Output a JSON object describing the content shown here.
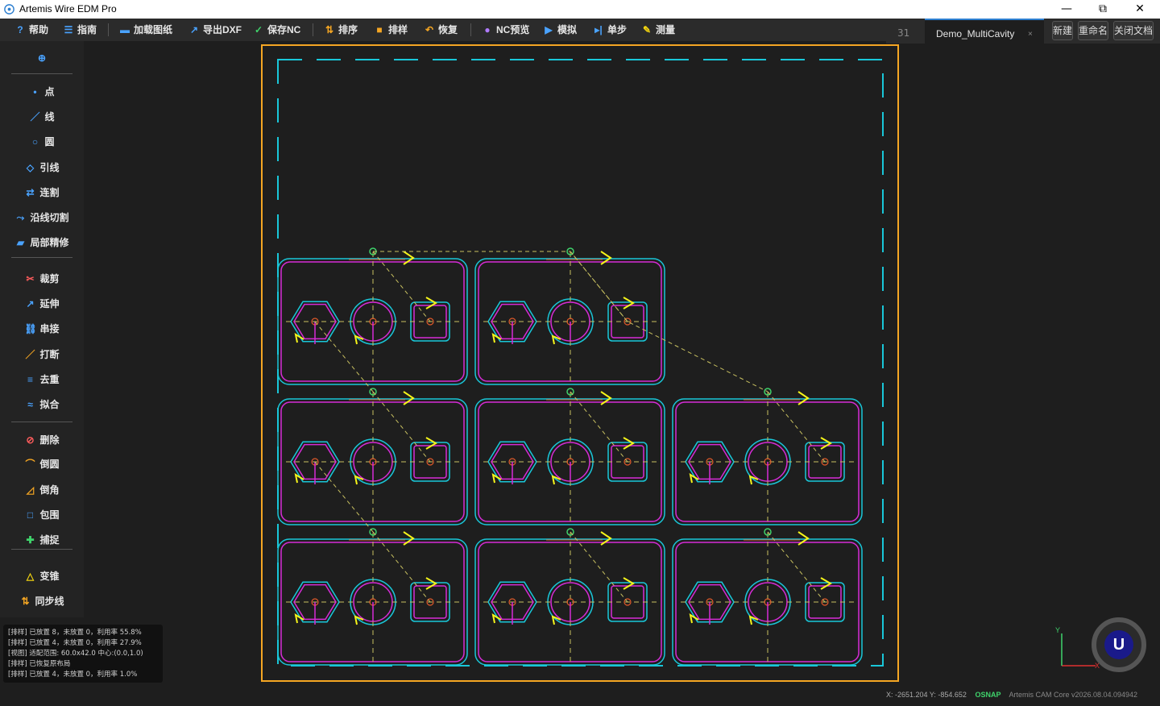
{
  "window": {
    "title": "Artemis Wire EDM Pro",
    "minimize": "—",
    "maximize": "⧉",
    "close": "✕"
  },
  "toolbar": {
    "items": [
      {
        "icon": "?",
        "label": "帮助"
      },
      {
        "icon": "☰",
        "label": "指南"
      },
      {
        "icon": "▬",
        "label": "加载图纸"
      },
      {
        "icon": "↗",
        "label": "导出DXF"
      },
      {
        "icon": "✓",
        "label": "保存NC"
      },
      {
        "icon": "⇅",
        "label": "排序"
      },
      {
        "icon": "■",
        "label": "排样"
      },
      {
        "icon": "↶",
        "label": "恢复"
      },
      {
        "icon": "●",
        "label": "NC预览"
      },
      {
        "icon": "▶",
        "label": "模拟"
      },
      {
        "icon": "▸|",
        "label": "单步"
      },
      {
        "icon": "✎",
        "label": "测量"
      }
    ]
  },
  "tabs": {
    "count": "31",
    "active_doc": "Demo_MultiCavity",
    "close": "×",
    "new": "新建",
    "rename": "重命名",
    "close_doc": "关闭文档"
  },
  "sidebar": {
    "pin": "⊕",
    "items": [
      {
        "icon": "•",
        "label": "点"
      },
      {
        "icon": "／",
        "label": "线"
      },
      {
        "icon": "○",
        "label": "圆"
      },
      {
        "icon": "◇",
        "label": "引线"
      },
      {
        "icon": "⇄",
        "label": "连割"
      },
      {
        "icon": "⤳",
        "label": "沿线切割"
      },
      {
        "icon": "▰",
        "label": "局部精修"
      },
      {
        "icon": "✂",
        "label": "裁剪"
      },
      {
        "icon": "↗",
        "label": "延伸"
      },
      {
        "icon": "⛓",
        "label": "串接"
      },
      {
        "icon": "／",
        "label": "打断"
      },
      {
        "icon": "≡",
        "label": "去重"
      },
      {
        "icon": "≈",
        "label": "拟合"
      },
      {
        "icon": "⊘",
        "label": "删除"
      },
      {
        "icon": "⌒",
        "label": "倒圆"
      },
      {
        "icon": "◿",
        "label": "倒角"
      },
      {
        "icon": "□",
        "label": "包围"
      },
      {
        "icon": "✚",
        "label": "捕捉"
      },
      {
        "icon": "△",
        "label": "变锥"
      },
      {
        "icon": "⇅",
        "label": "同步线"
      }
    ]
  },
  "log": [
    "[排样] 已放置 8，未放置 0，利用率 55.8%",
    "[排样] 已放置 4，未放置 0，利用率 27.9%",
    "[视图] 适配范围: 60.0x42.0 中心:(0.0,1.0)",
    "[排样] 已恢复原布局",
    "[排样] 已放置 4，未放置 0，利用率 1.0%"
  ],
  "status": {
    "coords": "X: -2651.204  Y: -854.652",
    "osnap": "OSNAP",
    "core": "Artemis CAM Core v2026.08.04.094942"
  },
  "axes": {
    "x": "X",
    "y": "Y"
  },
  "logo": "U",
  "colors": {
    "part_outline": "#19c7d9",
    "cut_path": "#d62bd6",
    "sheet": "#f5a623",
    "lead": "#f5f51a",
    "start": "#3fd36b"
  }
}
